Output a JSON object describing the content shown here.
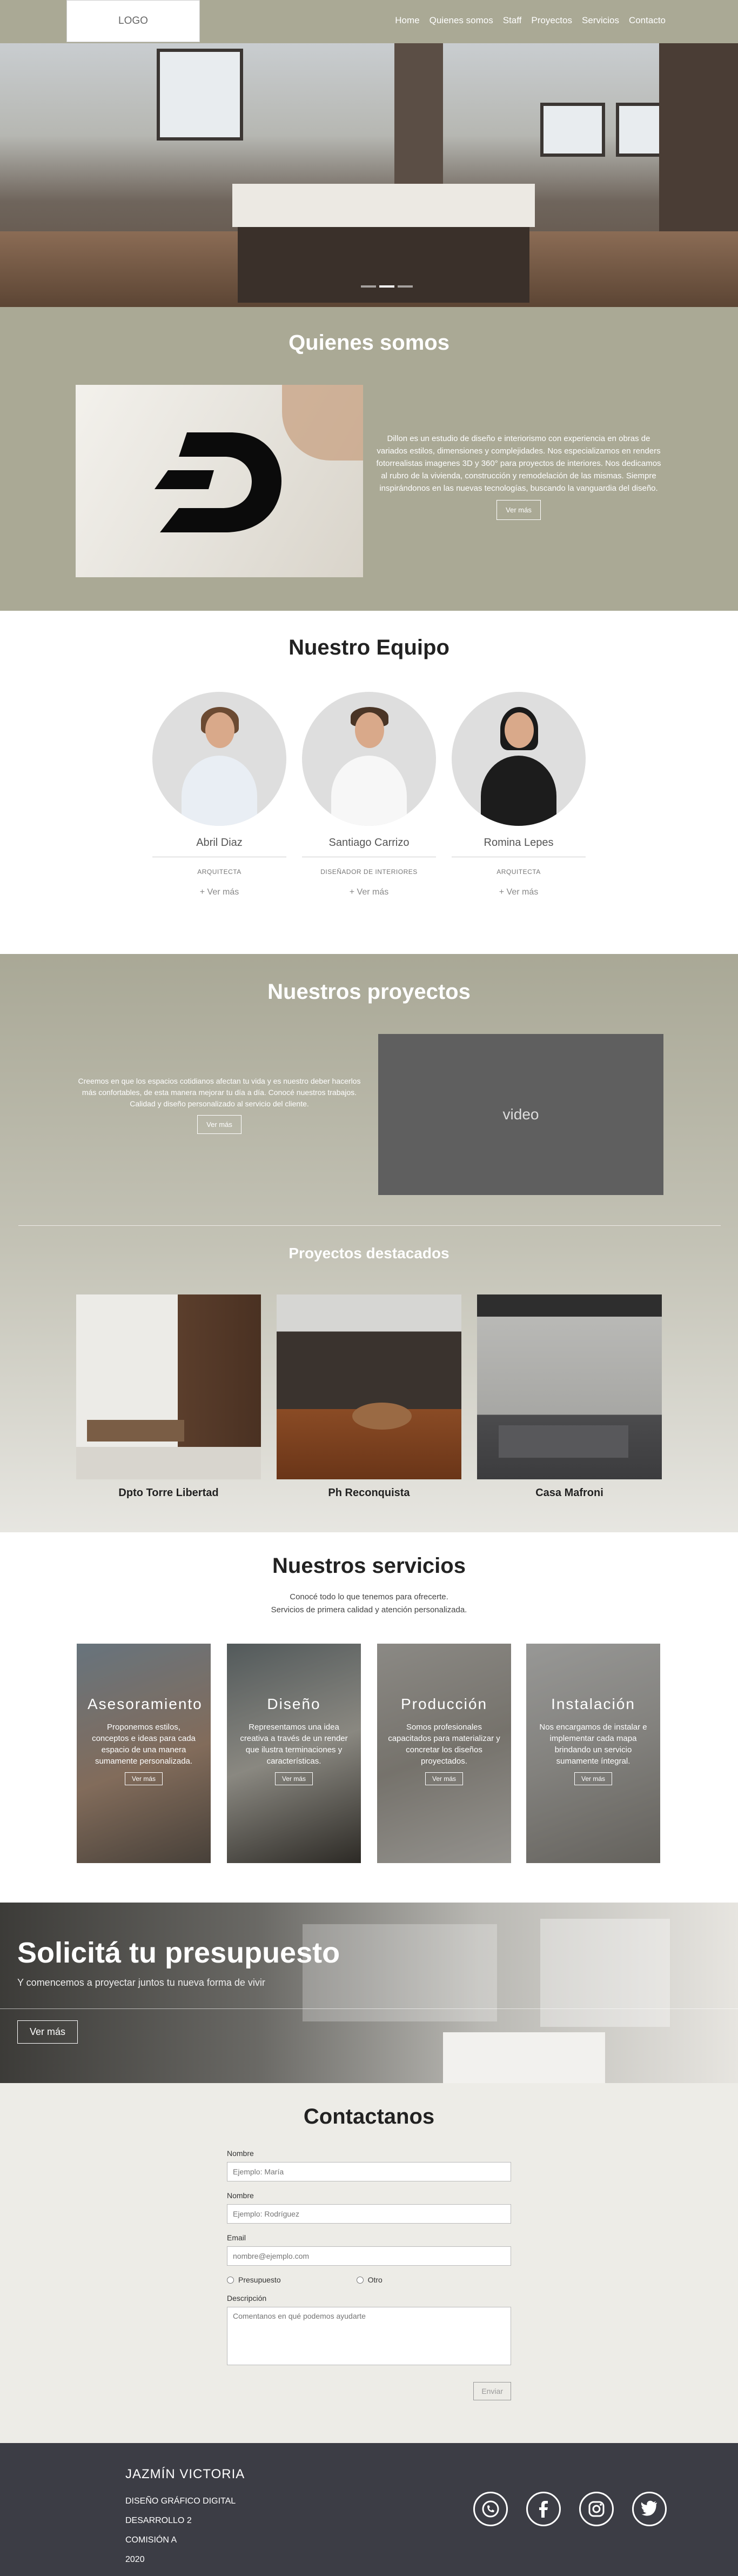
{
  "nav": {
    "logo": "LOGO",
    "links": [
      "Home",
      "Quienes somos",
      "Staff",
      "Proyectos",
      "Servicios",
      "Contacto"
    ]
  },
  "quienes": {
    "title": "Quienes somos",
    "text": "Dillon es un estudio de diseño e interiorismo con experiencia en obras de variados estilos, dimensiones y complejidades. Nos especializamos en renders fotorrealistas imagenes 3D y 360° para proyectos de interiores. Nos dedicamos al rubro de la vivienda, construcción y remodelación de las mismas. Siempre inspirándonos en las nuevas tecnologías, buscando la vanguardia del diseño.",
    "button": "Ver más"
  },
  "equipo": {
    "title": "Nuestro Equipo",
    "members": [
      {
        "name": "Abril Diaz",
        "role": "ARQUITECTA",
        "more": "+ Ver más"
      },
      {
        "name": "Santiago Carrizo",
        "role": "DISEÑADOR DE INTERIORES",
        "more": "+ Ver más"
      },
      {
        "name": "Romina Lepes",
        "role": "ARQUITECTA",
        "more": "+ Ver más"
      }
    ]
  },
  "proyectos": {
    "title": "Nuestros proyectos",
    "text": "Creemos en que los espacios cotidianos afectan tu vida y es nuestro deber hacerlos más confortables, de esta manera mejorar tu día a día. Conocé nuestros trabajos. Calidad y diseño personalizado al servicio del cliente.",
    "button": "Ver más",
    "video_label": "video",
    "destacados_title": "Proyectos destacados",
    "items": [
      "Dpto Torre Libertad",
      "Ph Reconquista",
      "Casa Mafroni"
    ]
  },
  "servicios": {
    "title": "Nuestros servicios",
    "subtitle_1": "Conocé todo lo que tenemos para ofrecerte.",
    "subtitle_2": "Servicios de primera calidad y atención personalizada.",
    "cards": [
      {
        "title": "Asesoramiento",
        "text": "Proponemos estilos, conceptos e ideas para cada espacio de una manera sumamente personalizada.",
        "button": "Ver más"
      },
      {
        "title": "Diseño",
        "text": "Representamos una idea creativa a través de un render que ilustra terminaciones y características.",
        "button": "Ver más"
      },
      {
        "title": "Producción",
        "text": "Somos profesionales capacitados para materializar y concretar los diseños proyectados.",
        "button": "Ver más"
      },
      {
        "title": "Instalación",
        "text": "Nos encargamos de instalar e implementar cada mapa brindando un servicio sumamente íntegral.",
        "button": "Ver más"
      }
    ]
  },
  "presupuesto": {
    "title": "Solicitá tu presupuesto",
    "subtitle": "Y comencemos a proyectar juntos tu nueva forma de vivir",
    "button": "Ver más"
  },
  "contacto": {
    "title": "Contactanos",
    "nombre_label": "Nombre",
    "nombre_placeholder": "Ejemplo: María",
    "apellido_label": "Nombre",
    "apellido_placeholder": "Ejemplo: Rodríguez",
    "email_label": "Email",
    "email_placeholder": "nombre@ejemplo.com",
    "radio_1": "Presupuesto",
    "radio_2": "Otro",
    "descripcion_label": "Descripción",
    "descripcion_placeholder": "Comentanos en qué podemos ayudarte",
    "submit": "Enviar"
  },
  "footer": {
    "name": "JAZMÍN VICTORIA",
    "line_1": "DISEÑO GRÁFICO DIGITAL",
    "line_2": "DESARROLLO 2",
    "line_3": "COMISIÓN A",
    "line_4": "2020",
    "socials": [
      "whatsapp-icon",
      "facebook-icon",
      "instagram-icon",
      "twitter-icon"
    ]
  }
}
